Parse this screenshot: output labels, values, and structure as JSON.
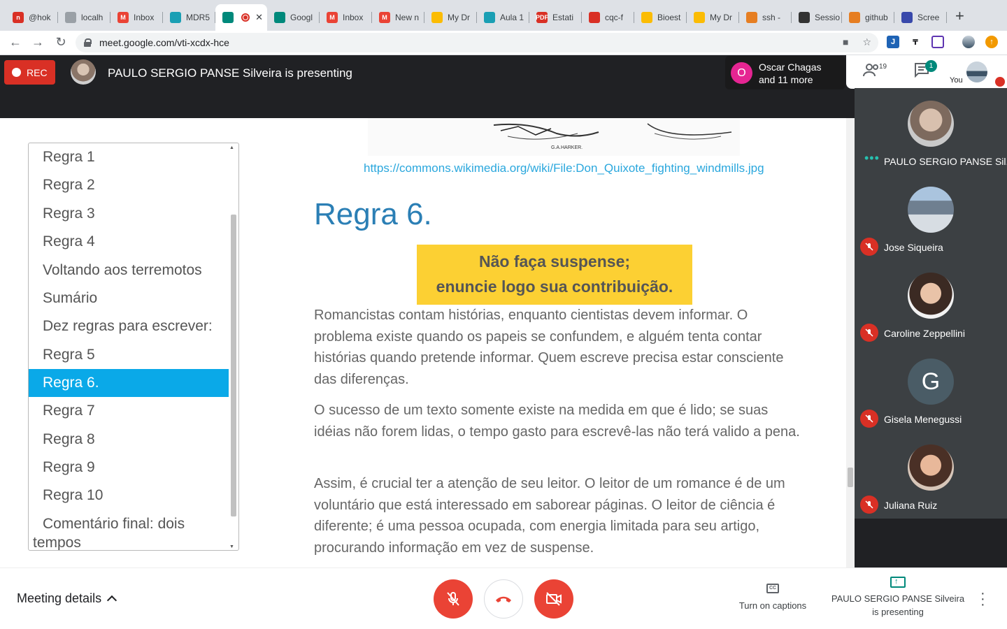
{
  "browser": {
    "tabs": [
      {
        "label": "@hok",
        "color": "#d93025",
        "glyph": "n"
      },
      {
        "label": "localh",
        "color": "#9aa0a6",
        "glyph": ""
      },
      {
        "label": "Inbox",
        "color": "#ea4335",
        "glyph": "M"
      },
      {
        "label": "MDR5",
        "color": "#1a9fb4",
        "glyph": ""
      },
      {
        "label": "",
        "color": "#00897b",
        "glyph": "",
        "active": true
      },
      {
        "label": "Googl",
        "color": "#00897b",
        "glyph": ""
      },
      {
        "label": "Inbox",
        "color": "#ea4335",
        "glyph": "M"
      },
      {
        "label": "New n",
        "color": "#ea4335",
        "glyph": "M"
      },
      {
        "label": "My Dr",
        "color": "#fbbc04",
        "glyph": ""
      },
      {
        "label": "Aula 1",
        "color": "#1a9fb4",
        "glyph": ""
      },
      {
        "label": "Estati",
        "color": "#d93025",
        "glyph": "PDF"
      },
      {
        "label": "cqc-f",
        "color": "#d93025",
        "glyph": ""
      },
      {
        "label": "Bioest",
        "color": "#fbbc04",
        "glyph": ""
      },
      {
        "label": "My Dr",
        "color": "#fbbc04",
        "glyph": ""
      },
      {
        "label": "ssh -",
        "color": "#e67e22",
        "glyph": ""
      },
      {
        "label": "Sessio",
        "color": "#333333",
        "glyph": ""
      },
      {
        "label": "github",
        "color": "#e67e22",
        "glyph": ""
      },
      {
        "label": "Scree",
        "color": "#3949ab",
        "glyph": ""
      }
    ],
    "new_tab": "+",
    "url": "meet.google.com/vti-xcdx-hce"
  },
  "meet": {
    "rec_label": "REC",
    "presenting_banner": "PAULO SERGIO PANSE Silveira is presenting",
    "chip_initial": "O",
    "chip_line1": "Oscar Chagas",
    "chip_line2": "and 11 more",
    "participants_count": "19",
    "chat_count": "1",
    "you_label": "You"
  },
  "slide": {
    "outline": [
      "Regra 1",
      "Regra 2",
      "Regra 3",
      "Regra 4",
      "Voltando aos terremotos",
      "Sumário",
      "Dez regras para escrever:",
      "Regra 5",
      "Regra 6.",
      "Regra 7",
      "Regra 8",
      "Regra 9",
      "Regra 10",
      "Comentário final: dois",
      "tempos"
    ],
    "selected_index": 8,
    "sketch_signature": "G.A.HARKER.",
    "link": "https://commons.wikimedia.org/wiki/File:Don_Quixote_fighting_windmills.jpg",
    "title": "Regra 6.",
    "callout_line1": "Não faça suspense;",
    "callout_line2": "enuncie logo sua contribuição.",
    "paragraphs": [
      "Romancistas contam histórias, enquanto cientistas devem informar. O problema existe quando os papeis se confundem, e alguém tenta contar histórias quando pretende informar. Quem escreve precisa estar consciente das diferenças.",
      "O sucesso de um texto somente existe na medida em que é lido; se suas idéias não forem lidas, o tempo gasto para escrevê-las não terá valido a pena.",
      "Assim, é crucial ter a atenção de seu leitor. O leitor de um romance é de um voluntário que está interessado em saborear páginas. O leitor de ciência é diferente; é uma pessoa ocupada, com energia limitada para seu artigo, procurando informação em vez de suspense."
    ]
  },
  "participants": [
    {
      "name": "PAULO SERGIO PANSE Sil...",
      "speaking": true
    },
    {
      "name": "Jose Siqueira",
      "muted": true
    },
    {
      "name": "Caroline Zeppellini",
      "muted": true
    },
    {
      "name": "Gisela Menegussi",
      "muted": true,
      "initial": "G"
    },
    {
      "name": "Juliana Ruiz",
      "muted": true
    }
  ],
  "bottom": {
    "meeting_details": "Meeting details",
    "captions": "Turn on captions",
    "cc": "CC",
    "present_line1": "PAULO SERGIO PANSE Silveira",
    "present_line2": "is presenting"
  },
  "colors": {
    "accent_red": "#ea4335",
    "meet_teal": "#00897b",
    "outline_selected": "#0aa9e8",
    "callout_yellow": "#fcd033",
    "title_blue": "#2b7fb5"
  }
}
